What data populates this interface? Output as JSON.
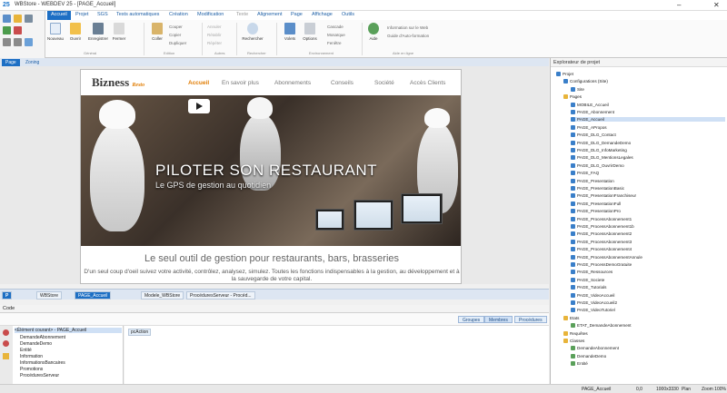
{
  "window": {
    "app": "WBStore",
    "title": "WBStore - WEBDEV 25 - [PAGE_Accueil]",
    "minimize": "–",
    "close": "✕"
  },
  "ribbon": {
    "tabs": [
      "Accueil",
      "Projet",
      "SGS",
      "Tests automatiques",
      "Création",
      "Modification",
      "Texte",
      "Alignement",
      "Page",
      "Affichage",
      "Outils"
    ],
    "active_tab": "Accueil",
    "buttons": [
      "Nouveau",
      "Ouvrir",
      "Enregistrer",
      "Fermer",
      "Coller",
      "Rechercher",
      "Volets",
      "Options",
      "Aide"
    ],
    "small_buttons": {
      "clipboard": [
        "Couper",
        "Copier",
        "Dupliquer"
      ],
      "edit": [
        "Annuler",
        "Rétablir",
        "Répéter"
      ],
      "windows": [
        "Cascade",
        "Mosaïque",
        "Fenêtre"
      ],
      "help": [
        "Information sur le Web",
        "Guide d'Auto-formation"
      ]
    },
    "groups": [
      "Général",
      "Edition",
      "Autres",
      "Rechercher",
      "Environnement",
      "Aide en ligne"
    ]
  },
  "doc_tabs": [
    "Page",
    "Zoning"
  ],
  "page": {
    "brand": "Bizness",
    "brand_sub": "Resto",
    "nav": [
      "Accueil",
      "En savoir plus",
      "Abonnements",
      "Conseils",
      "Société",
      "Accès Clients"
    ],
    "hero_title": "PILOTER SON RESTAURANT",
    "hero_subtitle": "Le GPS de gestion au quotidien",
    "tagline": "Le seul outil de gestion pour restaurants, bars, brasseries",
    "description": "D'un seul coup d'oeil suivez votre activité, contrôlez, analysez, simulez. Toutes les fonctions indispensables à la gestion, au développement et à la sauvegarde de votre capital.",
    "colors": {
      "accent": "#e07b00",
      "hero": "#4a3c31"
    }
  },
  "bottom_tabs": [
    "P",
    "WBStore",
    "PAGE_Accueil",
    "Modele_WBStore",
    "ProcéduresServeur - Procéd..."
  ],
  "code": {
    "header": "Code",
    "pills": [
      "Groupes",
      "Membres",
      "Procédures"
    ],
    "events": [
      "<Élément courant> - PAGE_Accueil",
      "DemandeAbonnement",
      "DemandeDemo",
      "Entité",
      "Information",
      "InformationsBancaires",
      "Promotions",
      "ProcéduresServeur"
    ],
    "area_tag": "pcAction"
  },
  "status": {
    "page": "PAGE_Accueil",
    "pos": "0,0",
    "size": "1000x3330",
    "mode": "Plan",
    "zoom": "Zoom 100%"
  },
  "project": {
    "title": "Explorateur de projet",
    "items": [
      {
        "label": "Projet",
        "level": 0,
        "c": "b"
      },
      {
        "label": "Configurations (Site)",
        "level": 1,
        "c": "b"
      },
      {
        "label": "Site",
        "level": 2,
        "c": "b"
      },
      {
        "label": "Pages",
        "level": 1,
        "c": "y"
      },
      {
        "label": "MOBILE_Accueil",
        "level": 2,
        "c": "b"
      },
      {
        "label": "PAGE_Abonnement",
        "level": 2,
        "c": "b"
      },
      {
        "label": "PAGE_Accueil",
        "level": 2,
        "c": "b",
        "sel": true
      },
      {
        "label": "PAGE_APropos",
        "level": 2,
        "c": "b"
      },
      {
        "label": "PAGE_DLG_Contact",
        "level": 2,
        "c": "b"
      },
      {
        "label": "PAGE_DLG_DemandeDemo",
        "level": 2,
        "c": "b"
      },
      {
        "label": "PAGE_DLG_InfoMarketing",
        "level": 2,
        "c": "b"
      },
      {
        "label": "PAGE_DLG_MentionsLegales",
        "level": 2,
        "c": "b"
      },
      {
        "label": "PAGE_DLG_OuvrirDemo",
        "level": 2,
        "c": "b"
      },
      {
        "label": "PAGE_FAQ",
        "level": 2,
        "c": "b"
      },
      {
        "label": "PAGE_Presentation",
        "level": 2,
        "c": "b"
      },
      {
        "label": "PAGE_PresentationBasic",
        "level": 2,
        "c": "b"
      },
      {
        "label": "PAGE_PresentationFranchiseur",
        "level": 2,
        "c": "b"
      },
      {
        "label": "PAGE_PresentationFull",
        "level": 2,
        "c": "b"
      },
      {
        "label": "PAGE_PresentationPro",
        "level": 2,
        "c": "b"
      },
      {
        "label": "PAGE_ProcessAbonnement1",
        "level": 2,
        "c": "b"
      },
      {
        "label": "PAGE_ProcessAbonnement1b",
        "level": 2,
        "c": "b"
      },
      {
        "label": "PAGE_ProcessAbonnement2",
        "level": 2,
        "c": "b"
      },
      {
        "label": "PAGE_ProcessAbonnement3",
        "level": 2,
        "c": "b"
      },
      {
        "label": "PAGE_ProcessAbonnement4",
        "level": 2,
        "c": "b"
      },
      {
        "label": "PAGE_ProcessAbonnementAnnule",
        "level": 2,
        "c": "b"
      },
      {
        "label": "PAGE_ProcessDemoGratuite",
        "level": 2,
        "c": "b"
      },
      {
        "label": "PAGE_Ressources",
        "level": 2,
        "c": "b"
      },
      {
        "label": "PAGE_Societe",
        "level": 2,
        "c": "b"
      },
      {
        "label": "PAGE_Tutorials",
        "level": 2,
        "c": "b"
      },
      {
        "label": "PAGE_VideoAccueil",
        "level": 2,
        "c": "b"
      },
      {
        "label": "PAGE_VideoAccueil2",
        "level": 2,
        "c": "b"
      },
      {
        "label": "PAGE_VideoTutoriel",
        "level": 2,
        "c": "b"
      },
      {
        "label": "Etats",
        "level": 1,
        "c": "y"
      },
      {
        "label": "ETAT_DemandeAbonnement",
        "level": 2,
        "c": "g"
      },
      {
        "label": "Requêtes",
        "level": 1,
        "c": "y"
      },
      {
        "label": "Classes",
        "level": 1,
        "c": "y"
      },
      {
        "label": "DemandeAbonnement",
        "level": 2,
        "c": "g"
      },
      {
        "label": "DemandeDemo",
        "level": 2,
        "c": "g"
      },
      {
        "label": "Entité",
        "level": 2,
        "c": "g"
      }
    ]
  }
}
